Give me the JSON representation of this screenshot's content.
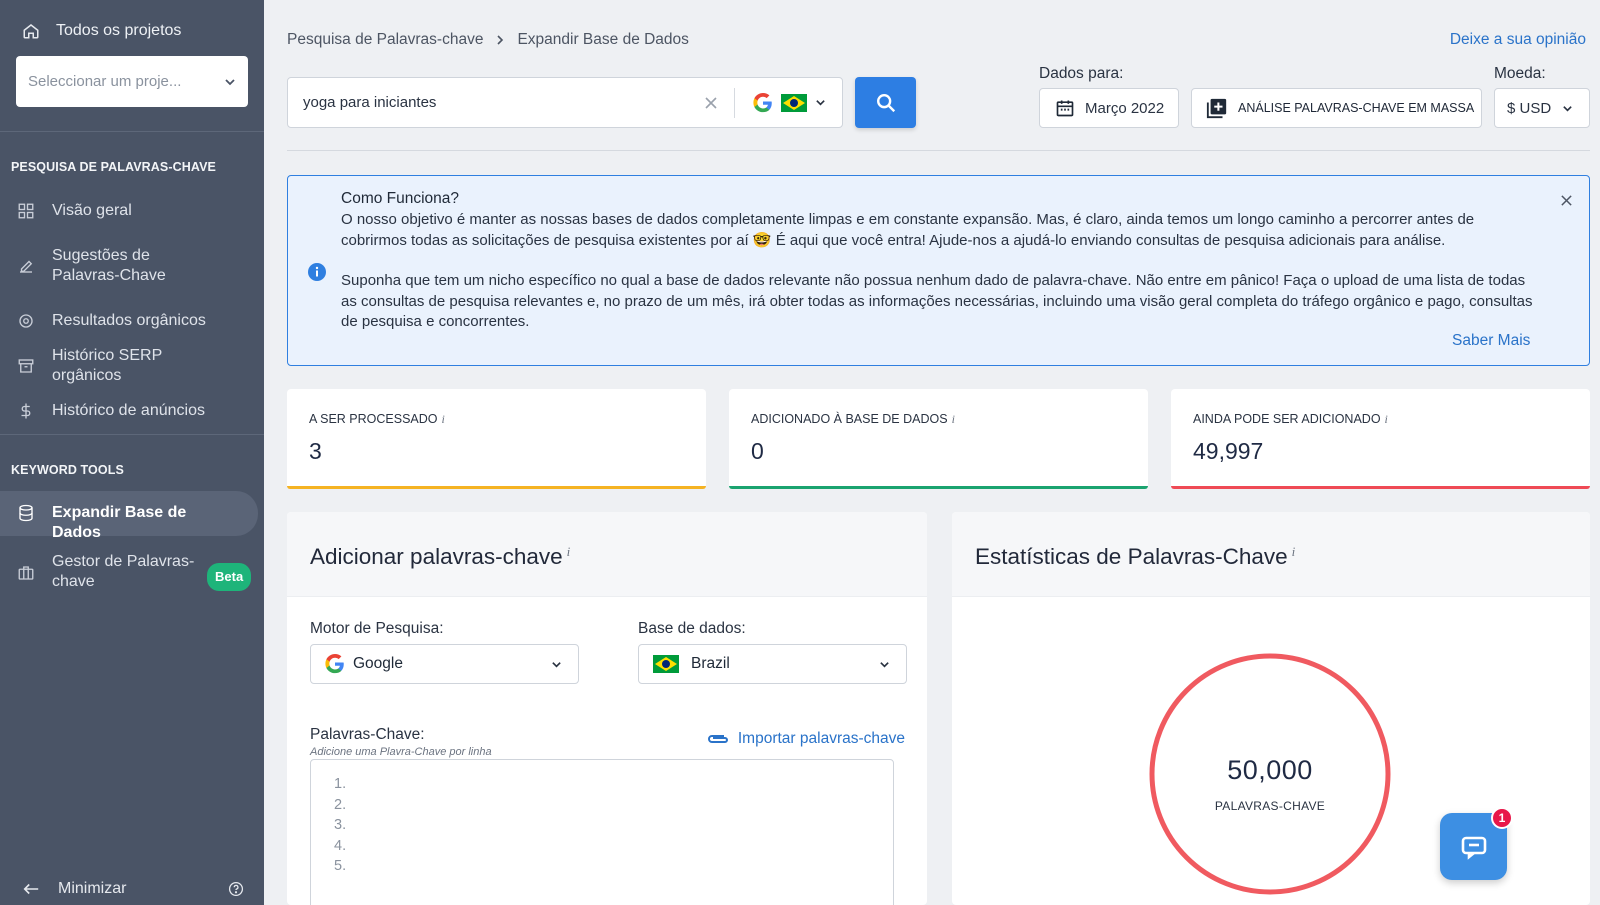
{
  "sidebar": {
    "all_projects": "Todos os projetos",
    "project_placeholder": "Seleccionar um proje...",
    "section_keyword_research": "PESQUISA DE PALAVRAS-CHAVE",
    "section_keyword_tools": "KEYWORD TOOLS",
    "items": [
      {
        "label": "Visão geral",
        "icon": "grid-icon"
      },
      {
        "label": "Sugestões de Palavras-Chave",
        "icon": "edit-icon"
      },
      {
        "label": "Resultados orgânicos",
        "icon": "target-icon"
      },
      {
        "label": "Histórico SERP orgânicos",
        "icon": "archive-icon"
      },
      {
        "label": "Histórico de anúncios",
        "icon": "dollar-icon"
      },
      {
        "label": "Expandir Base de Dados",
        "icon": "database-icon",
        "active": true
      },
      {
        "label": "Gestor de Palavras-chave",
        "icon": "briefcase-icon",
        "badge": "Beta"
      }
    ],
    "minimize": "Minimizar"
  },
  "header": {
    "breadcrumb": [
      "Pesquisa de Palavras-chave",
      "Expandir Base de Dados"
    ],
    "feedback": "Deixe a sua opinião",
    "search_value": "yoga para iniciantes",
    "dados_label": "Dados para:",
    "date": "Março 2022",
    "mass_analysis": "ANÁLISE PALAVRAS-CHAVE EM MASSA",
    "moeda_label": "Moeda:",
    "currency": "$ USD"
  },
  "info": {
    "title": "Como Funciona?",
    "p1": "O nosso objetivo é manter as nossas bases de dados completamente limpas e em constante expansão. Mas, é claro, ainda temos um longo caminho a percorrer antes de cobrirmos todas as solicitações de pesquisa existentes por aí 🤓 É aqui que você entra! Ajude-nos a ajudá-lo enviando consultas de pesquisa adicionais para análise.",
    "p2": "Suponha que tem um nicho específico no qual a base de dados relevante não possua nenhum dado de palavra-chave. Não entre em pânico! Faça o upload de uma lista de todas as consultas de pesquisa relevantes e, no prazo de um mês, irá obter todas as informações necessárias, incluindo uma visão geral completa do tráfego orgânico e pago, consultas de pesquisa e concorrentes.",
    "more": "Saber Mais"
  },
  "stats": [
    {
      "label": "A SER PROCESSADO",
      "value": "3",
      "color": "#f5b323"
    },
    {
      "label": "ADICIONADO À BASE DE DADOS",
      "value": "0",
      "color": "#1aa36f"
    },
    {
      "label": "AINDA PODE SER ADICIONADO",
      "value": "49,997",
      "color": "#ef4a55"
    }
  ],
  "add_panel": {
    "title": "Adicionar palavras-chave",
    "engine_label": "Motor de Pesquisa:",
    "engine_value": "Google",
    "db_label": "Base de dados:",
    "db_value": "Brazil",
    "kw_label": "Palavras-Chave:",
    "kw_sub": "Adicione uma Plavra-Chave por linha",
    "import": "Importar palavras-chave",
    "lines": [
      "1.",
      "2.",
      "3.",
      "4.",
      "5."
    ]
  },
  "stats_panel": {
    "title": "Estatísticas de Palavras-Chave",
    "total": "50,000",
    "total_label": "PALAVRAS-CHAVE",
    "ring_color": "#f05a60"
  },
  "chat": {
    "badge": "1"
  }
}
